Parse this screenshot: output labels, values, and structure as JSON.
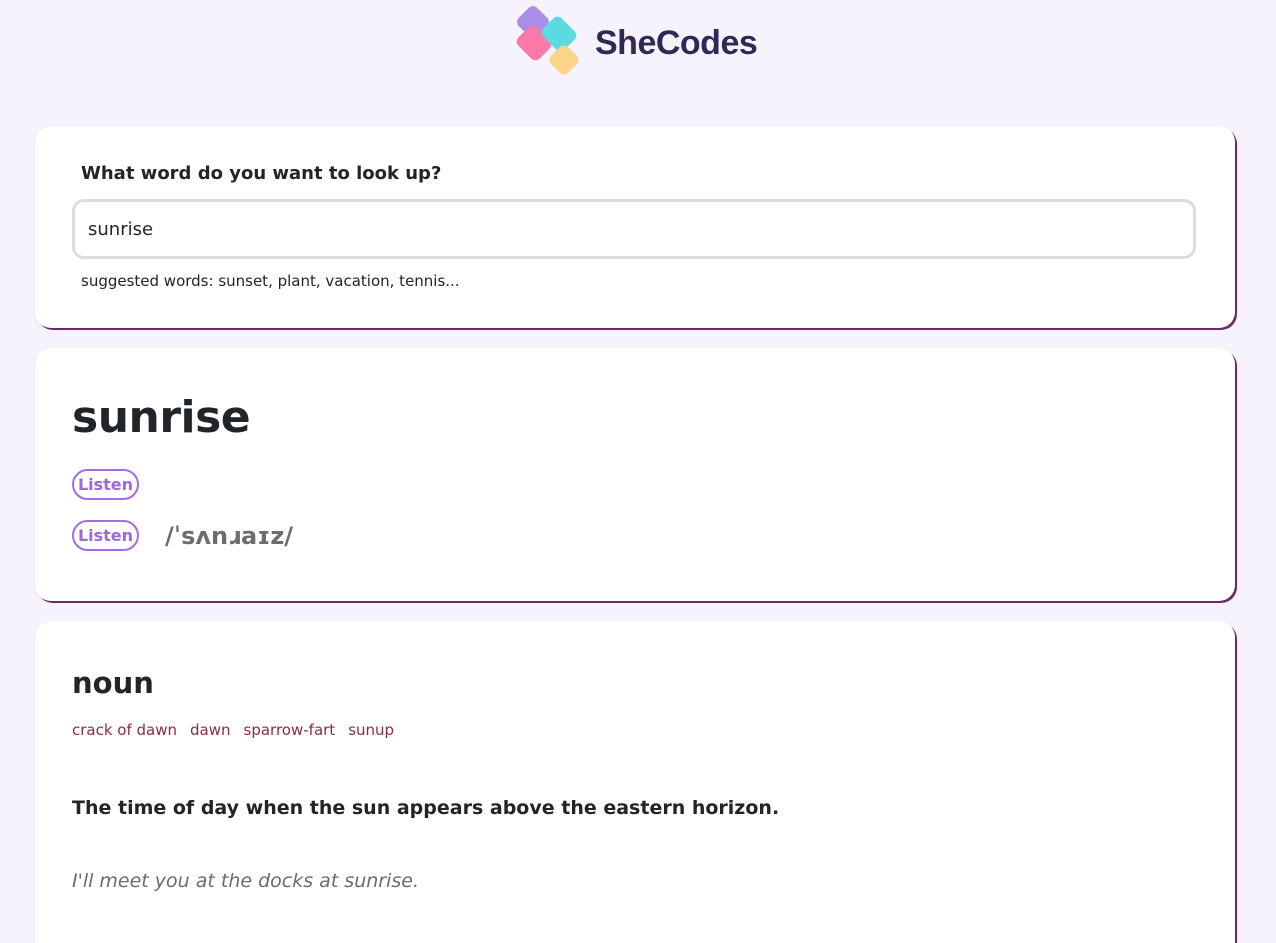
{
  "header": {
    "brand": "SheCodes"
  },
  "search": {
    "label": "What word do you want to look up?",
    "value": "sunrise",
    "hint": "suggested words: sunset, plant, vacation, tennis..."
  },
  "word": {
    "title": "sunrise",
    "phonetics": [
      {
        "button_label": "Listen",
        "text": ""
      },
      {
        "button_label": "Listen",
        "text": "/ˈsʌnɹaɪz/"
      }
    ]
  },
  "meaning": {
    "part_of_speech": "noun",
    "synonyms": [
      "crack of dawn",
      "dawn",
      "sparrow-fart",
      "sunup"
    ],
    "definition": "The time of day when the sun appears above the eastern horizon.",
    "example": "I'll meet you at the docks at sunrise."
  },
  "colors": {
    "background": "#f7f3fd",
    "accent_purple": "#a066dc",
    "synonym_red": "#8b2d3f",
    "card_shadow": "#6b2a66",
    "brand_text": "#2f2a55"
  }
}
